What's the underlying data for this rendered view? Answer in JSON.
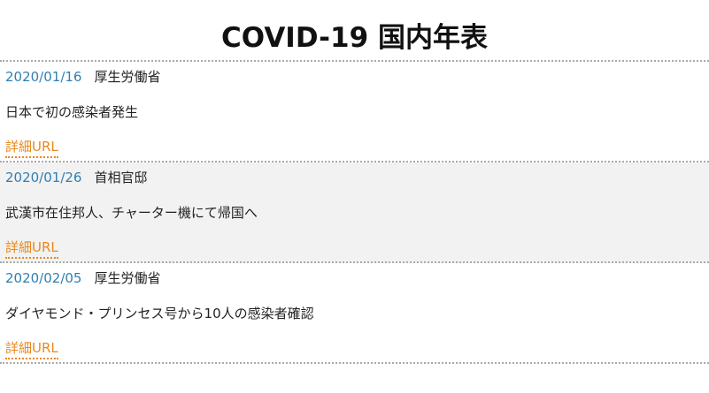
{
  "page": {
    "title": "COVID-19 国内年表"
  },
  "timeline": {
    "entries": [
      {
        "date": "2020/01/16",
        "source": "厚生労働省",
        "description": "日本で初の感染者発生",
        "link_label": "詳細URL"
      },
      {
        "date": "2020/01/26",
        "source": "首相官邸",
        "description": "武漢市在住邦人、チャーター機にて帰国へ",
        "link_label": "詳細URL"
      },
      {
        "date": "2020/02/05",
        "source": "厚生労働省",
        "description": "ダイヤモンド・プリンセス号から10人の感染者確認",
        "link_label": "詳細URL"
      }
    ]
  },
  "colors": {
    "date": "#2f7fb5",
    "link": "#e8891c",
    "alt_row_bg": "#f2f2f2",
    "divider": "#aaaaaa"
  }
}
